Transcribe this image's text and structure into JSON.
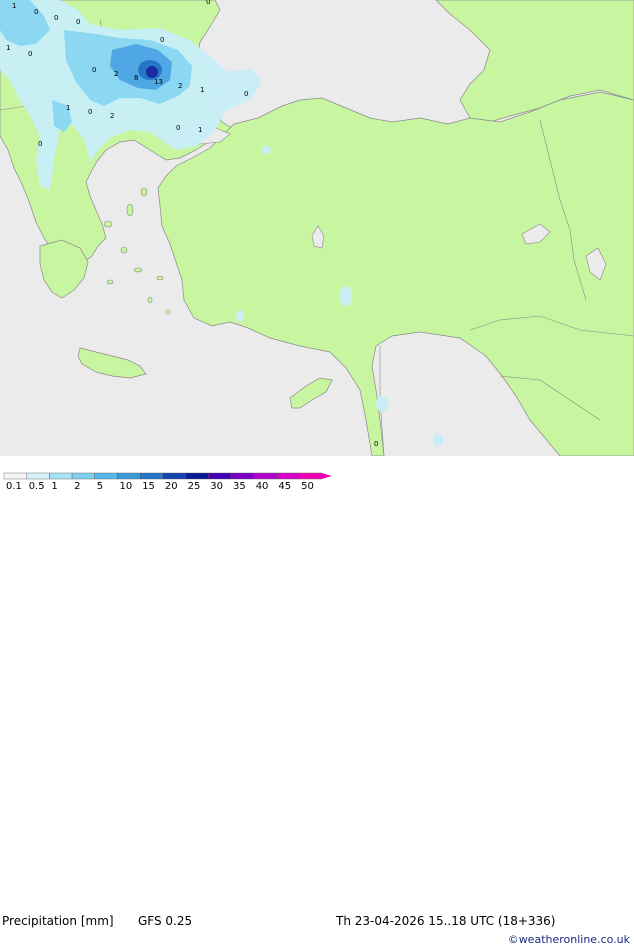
{
  "footer": {
    "title": "Precipitation [mm]",
    "model": "GFS 0.25",
    "valid_time": "Th 23-04-2026 15..18 UTC (18+336)",
    "credit": "©weatheronline.co.uk"
  },
  "legend": {
    "ticks": [
      "0.1",
      "0.5",
      "1",
      "2",
      "5",
      "10",
      "15",
      "20",
      "25",
      "30",
      "35",
      "40",
      "45",
      "50"
    ],
    "colors": [
      "#f5f5f5",
      "#d6f0fa",
      "#a8e2f6",
      "#7fd0ef",
      "#56b8e6",
      "#3a9ad8",
      "#2576c8",
      "#1546b0",
      "#0a1a96",
      "#4400b4",
      "#7a00c6",
      "#b000cc",
      "#d800c8",
      "#ee00b4"
    ]
  },
  "map": {
    "contour_labels": [
      "1",
      "0",
      "0",
      "0",
      "0",
      "1",
      "0",
      "0",
      "0",
      "2",
      "8",
      "13",
      "2",
      "1",
      "0",
      "1",
      "0",
      "2",
      "0",
      "1",
      "0",
      "0"
    ],
    "colors": {
      "sea": "#ebebeb",
      "land": "#c8f5a0",
      "precip_light": "#c8eef8",
      "precip_mid": "#8cd8f2",
      "precip_heavy": "#4fa8e4",
      "precip_max": "#1a2aa0"
    }
  }
}
